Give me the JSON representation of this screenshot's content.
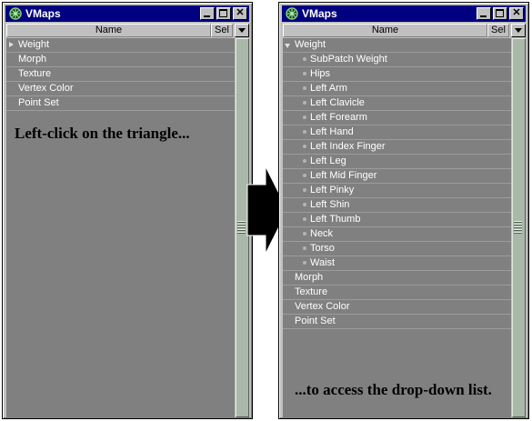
{
  "left_window": {
    "title": "VMaps",
    "columns": {
      "name": "Name",
      "sel": "Sel"
    },
    "rows": [
      {
        "label": "Weight",
        "expander": "collapsed"
      },
      {
        "label": "Morph"
      },
      {
        "label": "Texture"
      },
      {
        "label": "Vertex Color"
      },
      {
        "label": "Point Set"
      }
    ]
  },
  "right_window": {
    "title": "VMaps",
    "columns": {
      "name": "Name",
      "sel": "Sel"
    },
    "rows": [
      {
        "label": "Weight",
        "expander": "expanded"
      },
      {
        "label": "SubPatch Weight",
        "child": true
      },
      {
        "label": "Hips",
        "child": true
      },
      {
        "label": "Left Arm",
        "child": true
      },
      {
        "label": "Left Clavicle",
        "child": true
      },
      {
        "label": "Left Forearm",
        "child": true
      },
      {
        "label": "Left Hand",
        "child": true
      },
      {
        "label": "Left Index Finger",
        "child": true
      },
      {
        "label": "Left Leg",
        "child": true
      },
      {
        "label": "Left Mid Finger",
        "child": true
      },
      {
        "label": "Left Pinky",
        "child": true
      },
      {
        "label": "Left Shin",
        "child": true
      },
      {
        "label": "Left Thumb",
        "child": true
      },
      {
        "label": "Neck",
        "child": true
      },
      {
        "label": "Torso",
        "child": true
      },
      {
        "label": "Waist",
        "child": true
      },
      {
        "label": "Morph"
      },
      {
        "label": "Texture"
      },
      {
        "label": "Vertex Color"
      },
      {
        "label": "Point Set"
      }
    ]
  },
  "instructions": {
    "left": "Left-click on the triangle...",
    "right": "...to access the drop-down list."
  },
  "icons": {
    "app": "lightwave-icon",
    "expander_collapsed": "triangle-right-icon",
    "expander_expanded": "triangle-down-icon",
    "transition": "arrow-right-icon"
  },
  "colors": {
    "titlebar": "#000080",
    "list_bg": "#808080",
    "scrollbar": "#a9b8a9"
  }
}
